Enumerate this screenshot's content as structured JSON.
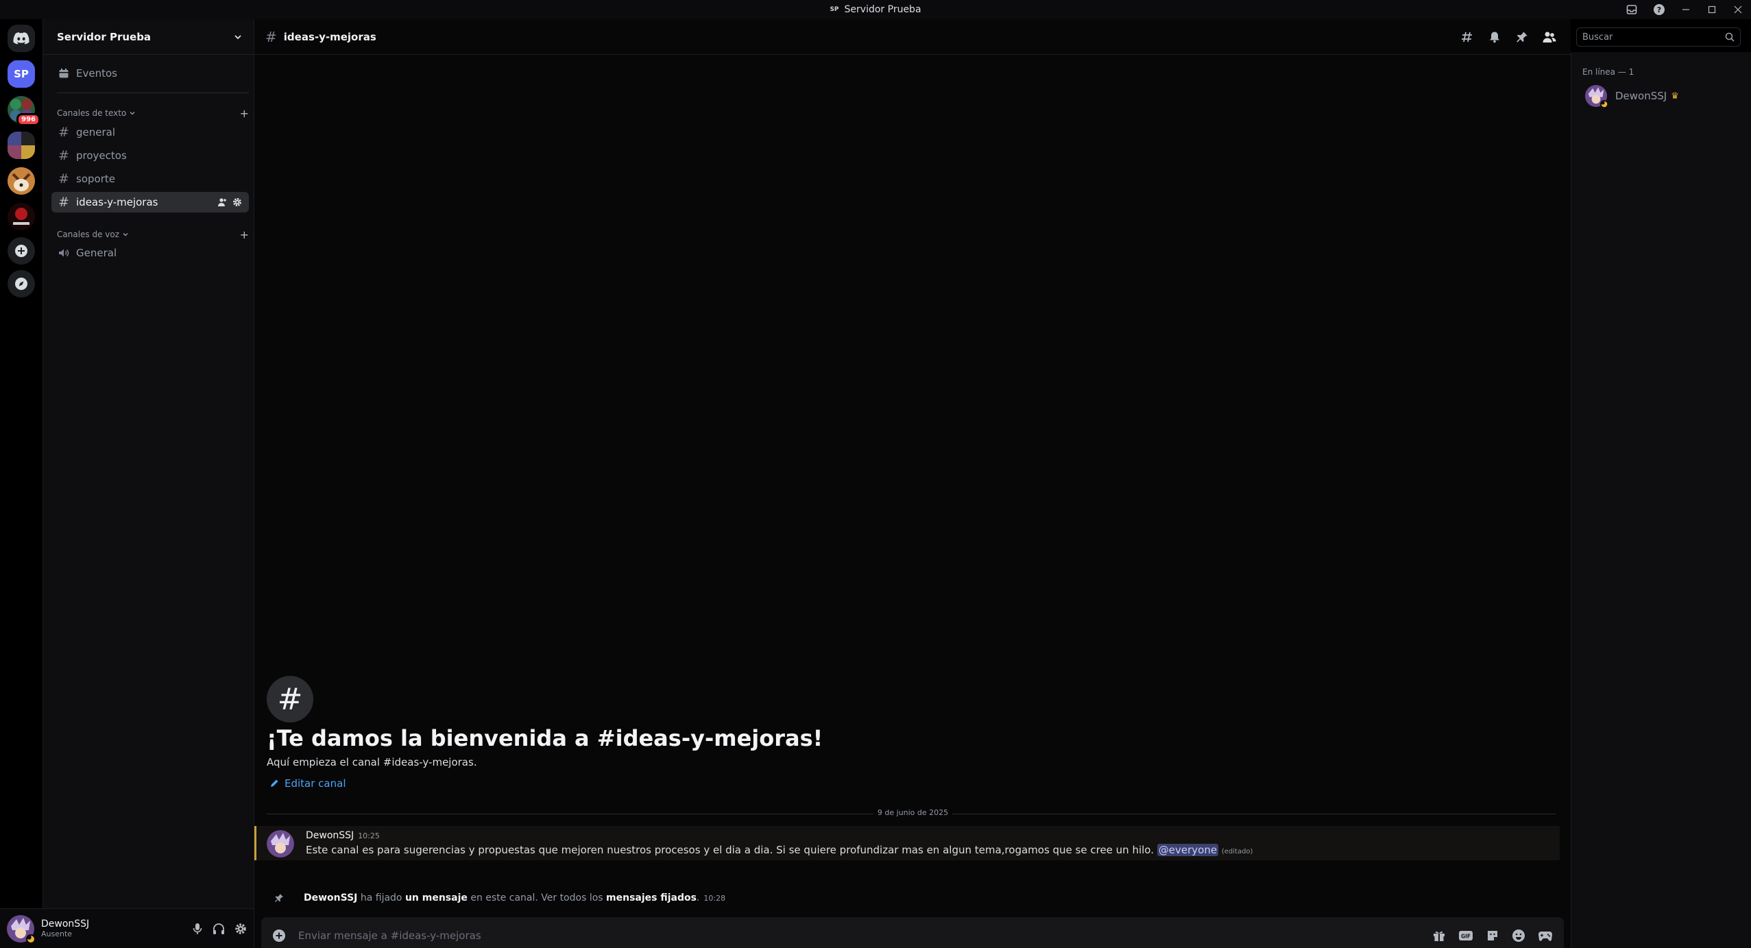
{
  "window": {
    "title": "Servidor Prueba",
    "title_badge": "SP"
  },
  "rail": {
    "badge_count": "996",
    "current_server_initials": "SP",
    "colors": {
      "current": "#5865f2",
      "home": "#1e1f22"
    }
  },
  "sidebar": {
    "server_name": "Servidor Prueba",
    "events_label": "Eventos",
    "text_category": "Canales de texto",
    "text_channels": [
      "general",
      "proyectos",
      "soporte",
      "ideas-y-mejoras"
    ],
    "voice_category": "Canales de voz",
    "voice_channels": [
      "General"
    ]
  },
  "user_panel": {
    "username": "DewonSSJ",
    "status": "Ausente"
  },
  "header": {
    "channel_name": "ideas-y-mejoras"
  },
  "search": {
    "placeholder": "Buscar"
  },
  "welcome": {
    "title": "¡Te damos la bienvenida a #ideas-y-mejoras!",
    "subtitle": "Aquí empieza el canal #ideas-y-mejoras.",
    "edit_label": "Editar canal"
  },
  "date_divider": "9 de junio de 2025",
  "messages": [
    {
      "author": "DewonSSJ",
      "time": "10:25",
      "text": "Este canal es para sugerencias y propuestas que mejoren nuestros procesos y el dia a dia. Si se quiere profundizar mas en algun tema,rogamos que se cree un hilo.",
      "mention": "@everyone",
      "edited": "(editado)"
    }
  ],
  "pin_notice": {
    "author": "DewonSSJ",
    "part1": "ha fijado",
    "link1": "un mensaje",
    "part2": "en este canal. Ver todos los",
    "link2": "mensajes fijados",
    "end": ".",
    "time": "10:28"
  },
  "composer": {
    "placeholder": "Enviar mensaje a #ideas-y-mejoras"
  },
  "members": {
    "section": "En línea — 1",
    "list": [
      {
        "name": "DewonSSJ",
        "crown": "♛"
      }
    ]
  },
  "icons": [
    "discord-icon",
    "inbox-icon",
    "help-icon",
    "calendar-icon",
    "hash-icon",
    "speaker-icon",
    "threads-icon",
    "bell-icon",
    "pin-icon",
    "members-icon",
    "search-icon",
    "gift-icon",
    "gif-icon",
    "sticker-icon",
    "emoji-icon",
    "game-icon",
    "mic-icon",
    "headphones-icon",
    "gear-icon",
    "add-server-icon",
    "discover-icon",
    "plus-circle-icon",
    "pencil-icon"
  ]
}
